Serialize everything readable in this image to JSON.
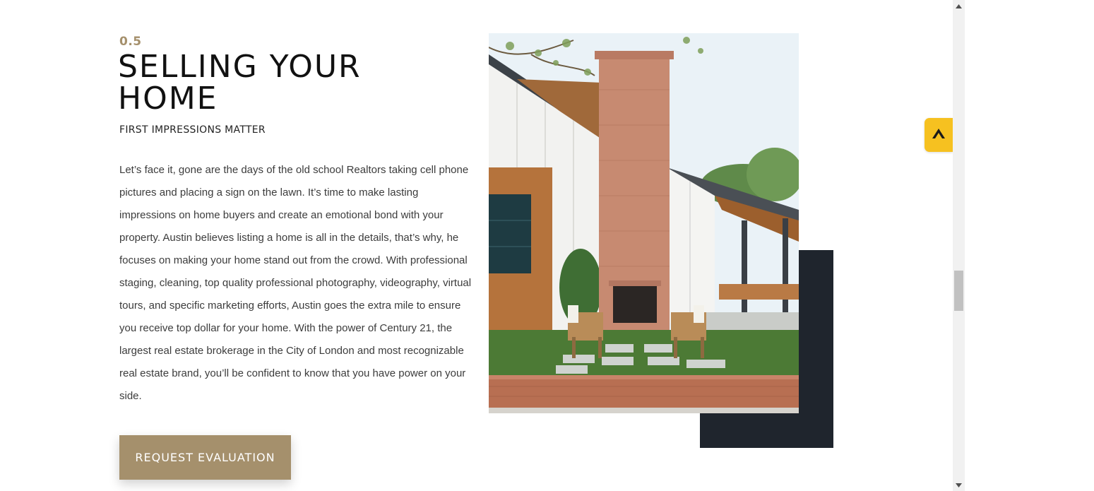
{
  "section": {
    "number": "0.5",
    "title": "SELLING YOUR HOME",
    "subtitle": "FIRST IMPRESSIONS MATTER",
    "body": "Let’s face it, gone are the days of the old school Realtors taking cell phone pictures and placing a sign on the lawn. It’s time to make lasting impressions on home buyers and create an emotional bond with your property. Austin believes listing a home is all in the details, that’s why, he focuses on making your home stand out from the crowd. With professional staging, cleaning, top quality professional photography, videography, virtual tours, and specific marketing efforts, Austin goes the extra mile to ensure you receive top dollar for your home.  With the power of Century 21, the largest real estate brokerage in the City of London and most recognizable real estate brand, you’ll be confident to know that you have power on your side.",
    "cta_label": "REQUEST EVALUATION"
  },
  "image": {
    "subject": "modern farmhouse backyard with brick chimney fireplace and two wooden chairs"
  },
  "widget": {
    "icon": "chevron-up-logo-icon"
  },
  "colors": {
    "accent": "#a5906c",
    "dark_block": "#1f252d",
    "widget": "#f6c120"
  }
}
